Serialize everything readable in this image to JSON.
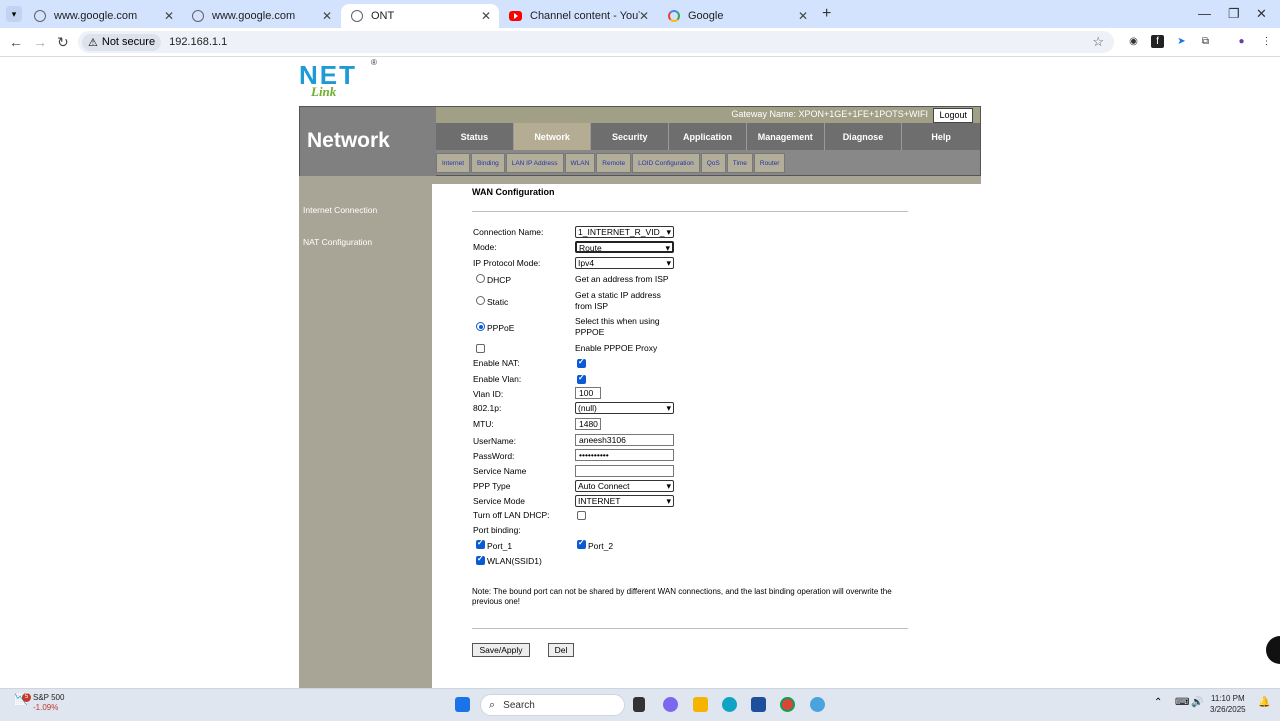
{
  "browser": {
    "tabs": [
      {
        "title": "www.google.com",
        "icon": "globe-icon"
      },
      {
        "title": "www.google.com",
        "icon": "globe-icon"
      },
      {
        "title": "ONT",
        "icon": "globe-icon"
      },
      {
        "title": "Channel content - YouTube Stu",
        "icon": "youtube-icon"
      },
      {
        "title": "Google",
        "icon": "google-icon"
      }
    ],
    "security_label": "Not secure",
    "url": "192.168.1.1"
  },
  "page": {
    "logo_text": "NET",
    "logo_sub": "Link",
    "logo_reg": "®",
    "section_title": "Network",
    "gateway_name": "Gateway Name: XPON+1GE+1FE+1POTS+WIFI",
    "logout_label": "Logout",
    "main_tabs": [
      "Status",
      "Network",
      "Security",
      "Application",
      "Management",
      "Diagnose",
      "Help"
    ],
    "sub_tabs": [
      "Internet",
      "Binding",
      "LAN IP Address",
      "WLAN",
      "Remote",
      "LOID Configuration",
      "QoS",
      "Time",
      "Router"
    ],
    "left_menu": [
      "Internet Connection",
      "NAT Configuration"
    ],
    "form_title": "WAN Configuration",
    "labels": {
      "connection_name": "Connection Name:",
      "mode": "Mode:",
      "ip_protocol_mode": "IP Protocol Mode:",
      "dhcp": "DHCP",
      "static": "Static",
      "pppoe": "PPPoE",
      "enable_nat": "Enable NAT:",
      "enable_vlan": "Enable Vlan:",
      "vlan_id": "Vlan ID:",
      "p8021": "802.1p:",
      "mtu": "MTU:",
      "username": "UserName:",
      "password": "PassWord:",
      "service_name": "Service Name",
      "ppp_type": "PPP Type",
      "service_mode": "Service Mode",
      "turn_off_lan_dhcp": "Turn off LAN DHCP:",
      "port_binding": "Port binding:",
      "port_1": "Port_1",
      "port_2": "Port_2",
      "wlan_ssid1": "WLAN(SSID1)"
    },
    "descriptions": {
      "dhcp": "Get an address from ISP",
      "static": "Get a static IP address from ISP",
      "pppoe": "Select this when using PPPOE",
      "pppoe_proxy": "Enable PPPOE Proxy"
    },
    "values": {
      "connection_name": "1_INTERNET_R_VID_",
      "mode": "Route",
      "ip_protocol_mode": "Ipv4",
      "vlan_id": "100",
      "p8021": "(null)",
      "mtu": "1480",
      "username": "aneesh3106",
      "password": "••••••••••",
      "service_name": "",
      "ppp_type": "Auto Connect",
      "service_mode": "INTERNET"
    },
    "note": "Note: The bound port can not be shared by different WAN connections, and the last binding operation will overwrite the previous one!",
    "save_label": "Save/Apply",
    "del_label": "Del"
  },
  "taskbar": {
    "stock_name": "S&P 500",
    "stock_change": "-1.09%",
    "notification_count": "5",
    "search_label": "Search",
    "time": "11:10 PM",
    "date": "3/26/2025"
  }
}
